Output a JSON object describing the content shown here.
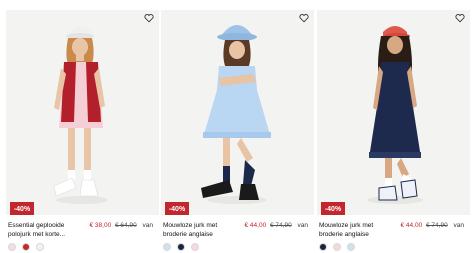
{
  "products": [
    {
      "title": "Essential geplooide polojurk met korte...",
      "discount": "-40%",
      "price_new": "€ 38,00",
      "price_old": "€ 64,90",
      "price_suffix": "van",
      "swatch_colors": [
        "#f2dede",
        "#c62828",
        "#eef3fa"
      ],
      "colors": {
        "cap": "#f0f0f0",
        "dress": "#f6cfd6",
        "vest": "#b3202b",
        "hair": "#c98a4b",
        "skin": "#e9c5a8",
        "shoes": "#ffffff"
      }
    },
    {
      "title": "Mouwloze jurk met broderie anglaise",
      "discount": "-40%",
      "price_new": "€ 44,00",
      "price_old": "€ 74,90",
      "price_suffix": "van",
      "swatch_colors": [
        "#cfe0f3",
        "#1c2540",
        "#f7d8dc"
      ],
      "colors": {
        "hat": "#9fc3e6",
        "dress": "#b9d6f2",
        "hair": "#5a3a24",
        "skin": "#e8c3a4",
        "socks": "#1b2a4a",
        "shoes": "#1a1a1a"
      }
    },
    {
      "title": "Mouwloze jurk met broderie anglaise",
      "discount": "-40%",
      "price_new": "€ 44,00",
      "price_old": "€ 74,90",
      "price_suffix": "van",
      "swatch_colors": [
        "#1c2540",
        "#f7d8dc",
        "#cfe0f3"
      ],
      "colors": {
        "cap": "#e2574c",
        "dress": "#1d2a4d",
        "hair": "#2a1d16",
        "skin": "#d7a882",
        "socks": "#ffffff",
        "shoes": "#eef1f7"
      }
    }
  ],
  "accent": "#c2272d",
  "icons": {
    "wishlist": "heart-outline-icon"
  }
}
